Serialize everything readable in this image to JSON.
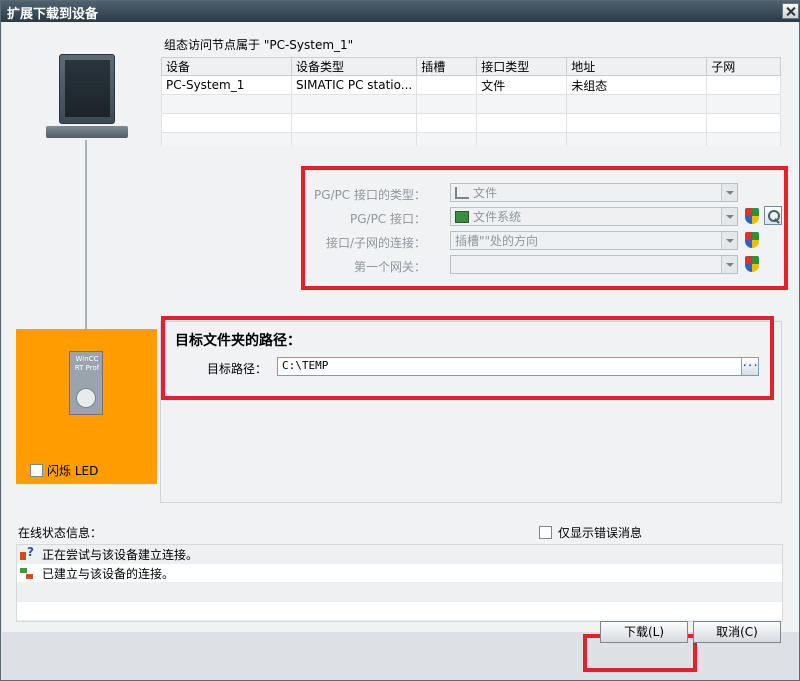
{
  "window": {
    "title": "扩展下载到设备"
  },
  "device_table": {
    "title": "组态访问节点属于 \"PC-System_1\"",
    "columns": [
      "设备",
      "设备类型",
      "插槽",
      "接口类型",
      "地址",
      "子网"
    ],
    "rows": [
      [
        "PC-System_1",
        "SIMATIC PC statio...",
        "",
        "文件",
        "未组态",
        ""
      ],
      [
        "",
        "",
        "",
        "",
        "",
        ""
      ],
      [
        "",
        "",
        "",
        "",
        "",
        ""
      ],
      [
        "",
        "",
        "",
        "",
        "",
        ""
      ]
    ]
  },
  "interface": {
    "type_label": "PG/PC 接口的类型：",
    "type_value": "文件",
    "iface_label": "PG/PC 接口：",
    "iface_value": "文件系统",
    "conn_label": "接口/子网的连接：",
    "conn_value": "插槽\"\"处的方向",
    "gateway_label": "第一个网关：",
    "gateway_value": ""
  },
  "device": {
    "label": "WinCC\nRT Prof",
    "led_label": "闪烁 LED"
  },
  "target": {
    "heading": "目标文件夹的路径：",
    "path_label": "目标路径：",
    "path_value": "C:\\TEMP",
    "browse": "..."
  },
  "status": {
    "title": "在线状态信息：",
    "errors_only_label": "仅显示错误消息",
    "messages": [
      {
        "icon": "trying-connect-icon",
        "text": "正在尝试与该设备建立连接。"
      },
      {
        "icon": "connected-icon",
        "text": "已建立与该设备的连接。"
      }
    ]
  },
  "buttons": {
    "download": "下载(L)",
    "cancel": "取消(C)"
  },
  "colors": {
    "highlight": "#e5202a",
    "device_panel": "#ff9d00",
    "titlebar": "#3a4a56"
  }
}
